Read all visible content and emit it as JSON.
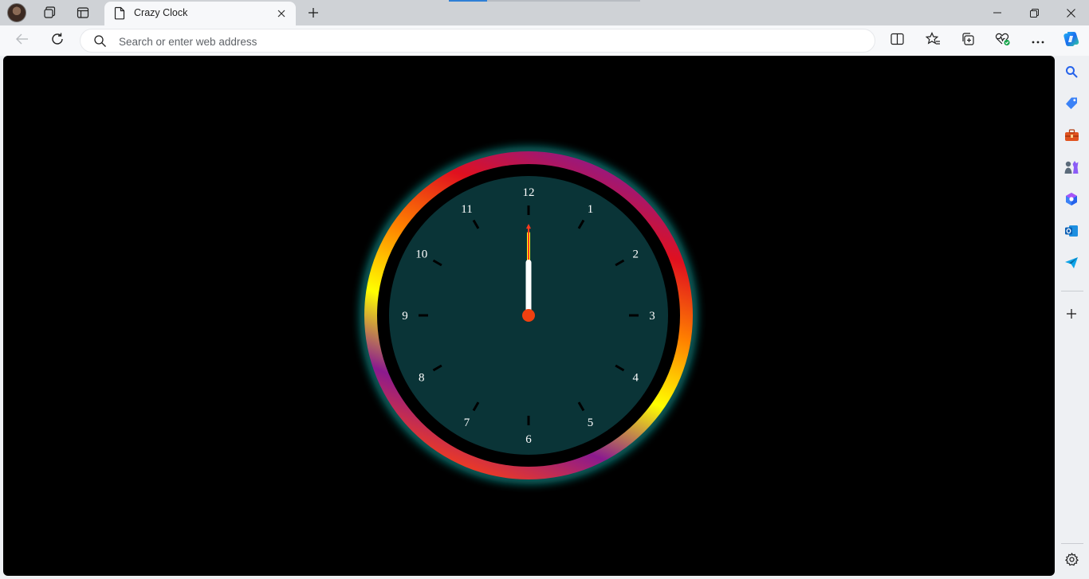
{
  "tabs": [
    {
      "title": "Crazy Clock",
      "active": true
    }
  ],
  "toolbar": {
    "address_placeholder": "Search or enter web address"
  },
  "clock": {
    "numerals": [
      "12",
      "1",
      "2",
      "3",
      "4",
      "5",
      "6",
      "7",
      "8",
      "9",
      "10",
      "11"
    ],
    "time": {
      "hours": 12,
      "minutes": 0,
      "seconds": 0
    },
    "colors": {
      "face": "#0a3437",
      "ring_inner": "#000000",
      "glow": "#19d6d0",
      "hour_hand": "#ffffff",
      "minute_hand": "#ffff1a",
      "second_hand": "#ff3b1f",
      "center_dot": "#f04010",
      "tick": "#000000"
    },
    "ring_gradient": [
      "#8b1a8f",
      "#e0101f",
      "#ff8000",
      "#ffff00",
      "#8b1a8f",
      "#ff4010"
    ]
  },
  "icons": {
    "workspaces": "workspaces-icon",
    "tab_actions": "tab-actions-icon",
    "page": "page-icon",
    "back": "back-arrow-icon",
    "refresh": "refresh-icon",
    "split": "split-screen-icon",
    "favorites": "favorites-icon",
    "collections": "collections-icon",
    "heart_pulse": "browser-essentials-icon",
    "more": "more-icon",
    "copilot": "copilot-icon"
  }
}
